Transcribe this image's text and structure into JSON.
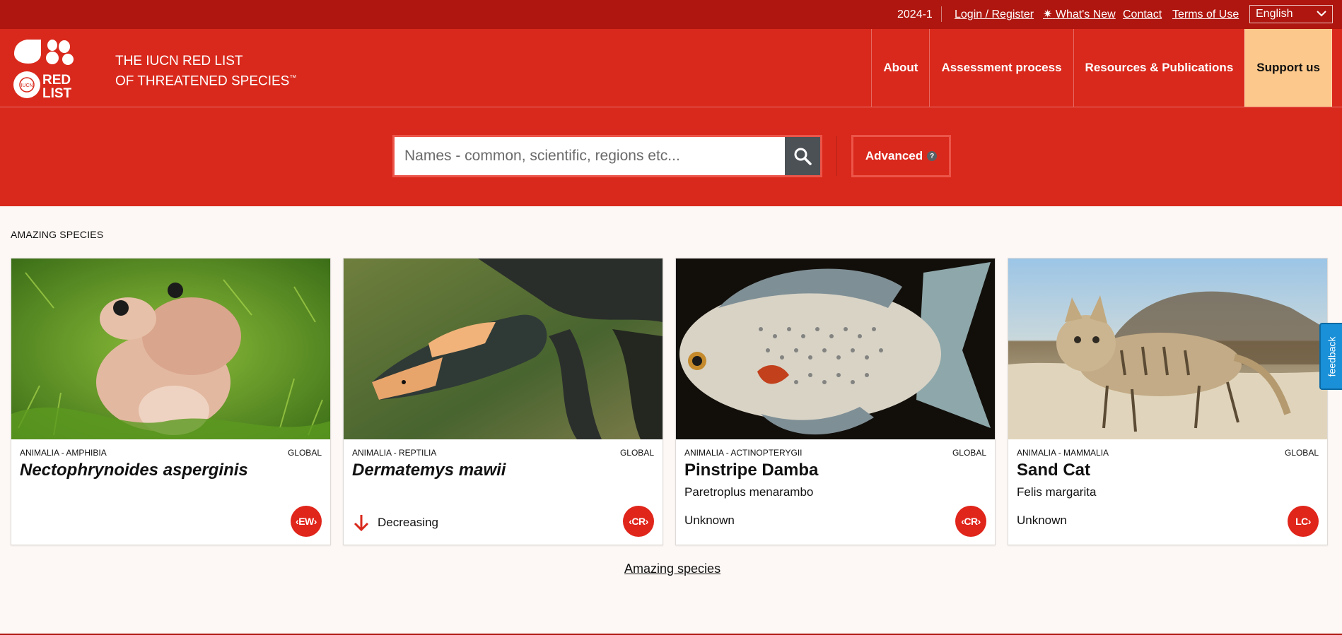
{
  "topbar": {
    "version": "2024-1",
    "login": "Login / Register",
    "whats_new": "What's New",
    "contact": "Contact",
    "terms": "Terms of Use",
    "language": "English"
  },
  "header": {
    "tagline_line1": "THE IUCN RED LIST",
    "tagline_line2": "OF THREATENED SPECIES",
    "tagline_mark": "™",
    "logo_text_top": "RED",
    "logo_text_bottom": "LIST",
    "logo_small": "IUCN",
    "nav": [
      "About",
      "Assessment process",
      "Resources & Publications",
      "Support us"
    ]
  },
  "search": {
    "placeholder": "Names - common, scientific, regions etc...",
    "advanced_label": "Advanced",
    "help_glyph": "?"
  },
  "amazing": {
    "section_title": "AMAZING SPECIES",
    "link_label": "Amazing species",
    "cards": [
      {
        "kingdom": "ANIMALIA - AMPHIBIA",
        "scope": "GLOBAL",
        "name": "Nectophrynoides asperginis",
        "scientific": "",
        "trend": "",
        "status": "EW"
      },
      {
        "kingdom": "ANIMALIA - REPTILIA",
        "scope": "GLOBAL",
        "name": "Dermatemys mawii",
        "scientific": "",
        "trend": "Decreasing",
        "status": "CR"
      },
      {
        "kingdom": "ANIMALIA - ACTINOPTERYGII",
        "scope": "GLOBAL",
        "name": "Pinstripe Damba",
        "scientific": "Paretroplus menarambo",
        "trend": "Unknown",
        "status": "CR"
      },
      {
        "kingdom": "ANIMALIA - MAMMALIA",
        "scope": "GLOBAL",
        "name": "Sand Cat",
        "scientific": "Felis margarita",
        "trend": "Unknown",
        "status": "LC"
      }
    ]
  },
  "feedback": {
    "label": "feedback"
  },
  "colors": {
    "topbar": "#ae160f",
    "brand_red": "#d9291c",
    "support_bg": "#fdc88b",
    "search_button": "#4c5156",
    "status_badge": "#e0251b",
    "feedback": "#1990d8"
  }
}
